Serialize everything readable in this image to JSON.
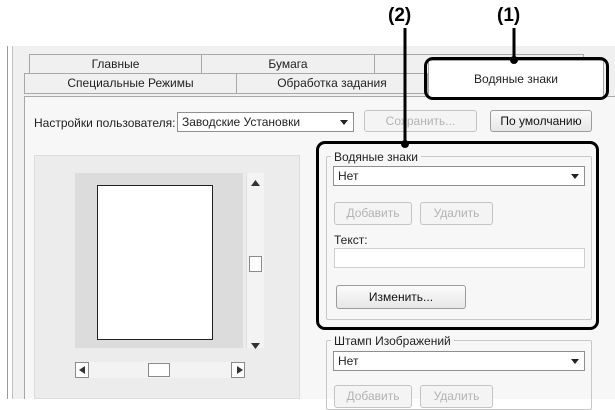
{
  "callouts": {
    "c1": "(1)",
    "c2": "(2)"
  },
  "tabs": {
    "row1": [
      "Главные",
      "Бумага",
      ""
    ],
    "row2": [
      "Специальные Режимы",
      "Обработка задания"
    ],
    "active": "Водяные знаки"
  },
  "user_settings": {
    "label": "Настройки пользователя:",
    "value": "Заводские Установки",
    "save": "Сохранить...",
    "default": "По умолчанию"
  },
  "watermarks": {
    "group": "Водяные знаки",
    "value": "Нет",
    "add": "Добавить",
    "delete": "Удалить",
    "text_label": "Текст:",
    "text_value": "",
    "edit": "Изменить..."
  },
  "image_stamp": {
    "group": "Штамп Изображений",
    "value": "Нет",
    "add": "Добавить",
    "delete": "Удалить"
  },
  "colors": {
    "callout": "#000000",
    "dialog_bg": "#f0f0f0"
  }
}
